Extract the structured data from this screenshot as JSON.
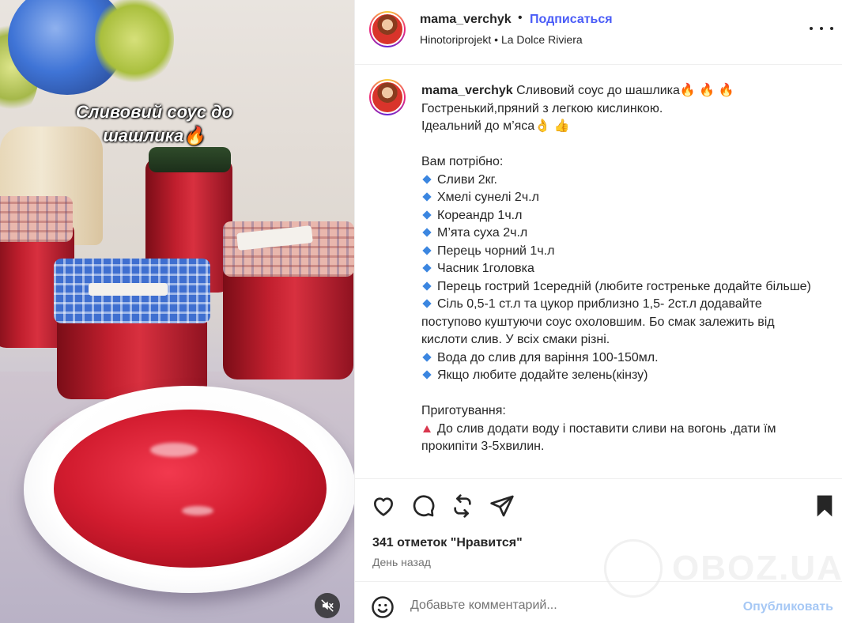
{
  "media": {
    "overlay_title_line1": "Сливовий соус до",
    "overlay_title_line2": "шашлика🔥"
  },
  "header": {
    "username": "mama_verchyk",
    "dot": "•",
    "follow_label": "Подписаться",
    "audio_artist": "Hinotoriprojekt",
    "audio_sep": "•",
    "audio_track": "La Dolce Riviera"
  },
  "caption": {
    "username": "mama_verchyk",
    "title": "Сливовий соус до шашлика🔥 🔥 🔥",
    "line_2": "Гостренький,пряний з легкою кислинкою.",
    "line_3": "Ідеальний до м’яса👌 👍",
    "line_4": "Вам потрібно:",
    "ing_1": "Сливи 2кг.",
    "ing_2": "Хмелі сунелі 2ч.л",
    "ing_3": "Кореандр 1ч.л",
    "ing_4": "М’ята суха 2ч.л",
    "ing_5": "Перець чорний 1ч.л",
    "ing_6": "Часник 1головка",
    "ing_7": "Перець гострий 1середній (любите гостреньке додайте більше)",
    "ing_8": "Сіль 0,5-1 ст.л та цукор приблизно 1,5- 2ст.л додавайте поступово куштуючи соус охоловшим. Бо смак залежить від кислоти слив. У всіх смаки різні.",
    "ing_9": "Вода до слив для варіння 100-150мл.",
    "ing_10": "Якщо любите додайте зелень(кінзу)",
    "prep_title": "Приготування:",
    "prep_1": "До слив додати воду і поставити сливи на вогонь ,дати їм прокипіти 3-5хвилин."
  },
  "actions": {
    "likes_text": "341 отметок \"Нравится\"",
    "time_text": "День назад"
  },
  "comment": {
    "placeholder": "Добавьте комментарий...",
    "publish_label": "Опубликовать"
  },
  "watermark": {
    "text": "OBOZ.UA"
  },
  "colors": {
    "link_blue": "#4a5cf7",
    "publish_disabled": "#a6c8f5",
    "diamond_blue": "#3b86e0",
    "triangle_red": "#d9364d"
  },
  "icons": [
    "heart-icon",
    "comment-icon",
    "repost-icon",
    "share-icon",
    "bookmark-icon",
    "emoji-icon",
    "mute-icon",
    "more-icon"
  ]
}
